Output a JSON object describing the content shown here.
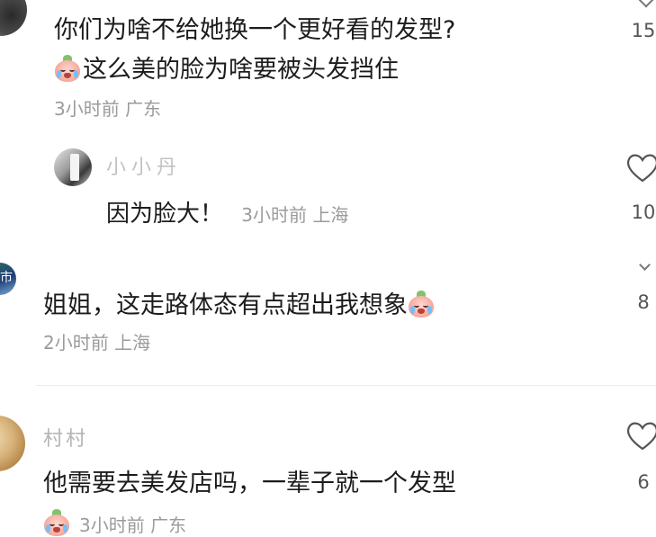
{
  "comments": [
    {
      "text_line1": "你们为啥不给她换一个更好看的发型?",
      "text_line2": "这么美的脸为啥要被头发挡住",
      "emoji": "crying-emoji",
      "meta": "3小时前 广东",
      "like_count": "15"
    },
    {
      "username": "小小丹",
      "text": "因为脸大！",
      "meta": "3小时前 上海",
      "like_count": "10",
      "is_reply": true
    },
    {
      "text": "姐姐，这走路体态有点超出我想象",
      "emoji": "crying-emoji",
      "meta": "2小时前 上海",
      "like_count": "8"
    },
    {
      "username": "村村",
      "text": "他需要去美发店吗，一辈子就一个发型",
      "meta_partial": "3小时前 广东",
      "like_count": "6"
    }
  ],
  "avatar_glyph": "市",
  "colors": {
    "text": "#1c1c1c",
    "meta": "#9b9b9b",
    "username": "#a8a8a8",
    "emoji_face": "#f5a79b",
    "emoji_leaf": "#7fc36a",
    "emoji_tear": "#6ec0ff"
  }
}
